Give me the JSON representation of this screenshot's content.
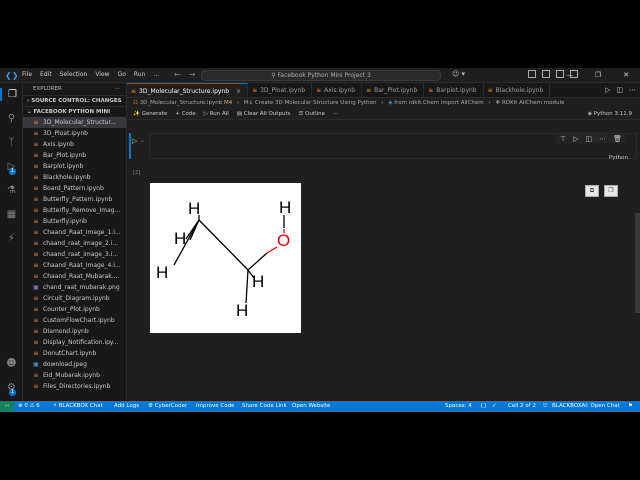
{
  "titlebar": {
    "menu": [
      "File",
      "Edit",
      "Selection",
      "View",
      "Go",
      "Run",
      "..."
    ],
    "command_center": "Facebook Python Mini Project 3"
  },
  "sidebar": {
    "header": "EXPLORER",
    "source_control": "SOURCE CONTROL: CHANGES",
    "folder": "FACEBOOK PYTHON MINI PROJE...",
    "files": [
      {
        "name": "3D_Molecular_Structur...",
        "type": "nb",
        "selected": true
      },
      {
        "name": "3D_Ploat.ipynb",
        "type": "nb"
      },
      {
        "name": "Axis.ipynb",
        "type": "nb"
      },
      {
        "name": "Bar_Plot.ipynb",
        "type": "nb"
      },
      {
        "name": "Barplot.ipynb",
        "type": "nb"
      },
      {
        "name": "Blackhole.ipynb",
        "type": "nb"
      },
      {
        "name": "Board_Pattern.ipynb",
        "type": "nb"
      },
      {
        "name": "Butterfly_Pattern.ipynb",
        "type": "nb"
      },
      {
        "name": "Butterfly_Remove_Imag...",
        "type": "nb"
      },
      {
        "name": "Butterfly.ipynb",
        "type": "nb"
      },
      {
        "name": "Chaand_Raat_Image_1.i...",
        "type": "nb"
      },
      {
        "name": "chaand_raat_image_2.i...",
        "type": "nb"
      },
      {
        "name": "chaand_raat_image_3.i...",
        "type": "nb"
      },
      {
        "name": "Chaand_Raat_Image_4.i...",
        "type": "nb"
      },
      {
        "name": "Chaand_Raat_Mubarak....",
        "type": "nb"
      },
      {
        "name": "chand_raat_mubarak.png",
        "type": "img"
      },
      {
        "name": "Circuit_Diagram.ipynb",
        "type": "nb"
      },
      {
        "name": "Counter_Plot.ipynb",
        "type": "nb"
      },
      {
        "name": "CustomFlowChart.ipynb",
        "type": "nb"
      },
      {
        "name": "Diamond.ipynb",
        "type": "nb"
      },
      {
        "name": "Display_Notification.ipy...",
        "type": "nb"
      },
      {
        "name": "DonutChart.ipynb",
        "type": "nb"
      },
      {
        "name": "download.jpeg",
        "type": "jpg"
      },
      {
        "name": "Eid_Mubarak.ipynb",
        "type": "nb"
      },
      {
        "name": "Files_Directories.ipynb",
        "type": "nb"
      }
    ]
  },
  "tabs": [
    {
      "label": "3D_Molecular_Structure.ipynb",
      "active": true
    },
    {
      "label": "3D_Ploat.ipynb"
    },
    {
      "label": "Axis.ipynb"
    },
    {
      "label": "Bar_Plot.ipynb"
    },
    {
      "label": "Barplot.ipynb"
    },
    {
      "label": "Blackhole.ipynb"
    }
  ],
  "breadcrumb": {
    "file": "3D_Molecular_Structure.ipynb",
    "marker": "M4",
    "section": "Create 3D Molecular Structure Using Python",
    "code": "from rdkit.Chem import AllChem",
    "symbol": "RDKit AllChem module"
  },
  "toolbar": {
    "generate": "Generate",
    "code": "+ Code",
    "run_all": "Run All",
    "clear": "Clear All Outputs",
    "outline": "Outline",
    "kernel": "Python 3.11.9"
  },
  "cell": {
    "language": "Python",
    "exec_count": "[2]"
  },
  "molecule": {
    "atoms": [
      "H",
      "H",
      "H",
      "O",
      "H",
      "H"
    ]
  },
  "statusbar": {
    "errors": "0",
    "warnings": "6",
    "blackbox": "BLACKBOX Chat",
    "addlogs": "Add Logs",
    "cybercoder": "CyberCoder",
    "improve": "Improve Code",
    "share": "Share Code Link",
    "website": "Open Website",
    "spaces": "Spaces: 4",
    "cell_pos": "Cell 2 of 2",
    "blackboxai": "BLACKBOXAI: Open Chat"
  }
}
